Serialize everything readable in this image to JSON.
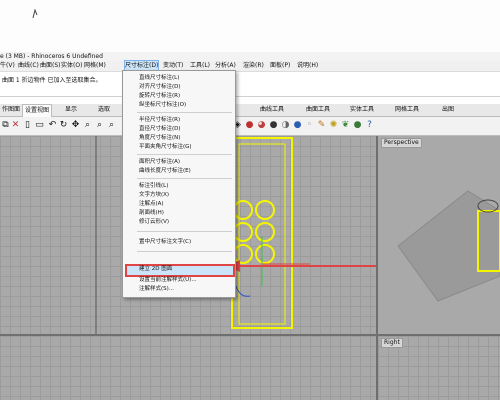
{
  "app": {
    "title": "e (3 MB) - Rhinoceros 6 Undefined"
  },
  "menubar": {
    "items": [
      {
        "label": "牛(V)"
      },
      {
        "label": "曲线(C)"
      },
      {
        "label": "曲面(S)"
      },
      {
        "label": "实体(O)"
      },
      {
        "label": "网格(M)"
      },
      {
        "label": "尺寸标注(D)"
      },
      {
        "label": "变动(T)"
      },
      {
        "label": "工具(L)"
      },
      {
        "label": "分析(A)"
      },
      {
        "label": "渲染(R)"
      },
      {
        "label": "面板(P)"
      },
      {
        "label": "说明(H)"
      }
    ]
  },
  "command": {
    "line1": "曲面 1 折边物件 已加入至选取集合。"
  },
  "tabs": [
    {
      "label": "作图面"
    },
    {
      "label": "设置视图"
    },
    {
      "label": "显示"
    },
    {
      "label": "选取"
    },
    {
      "label": "曲线工具"
    },
    {
      "label": "曲面工具"
    },
    {
      "label": "实体工具"
    },
    {
      "label": "网格工具"
    },
    {
      "label": "出图"
    }
  ],
  "viewports": {
    "perspective": "Perspective",
    "right": "Right"
  },
  "dropdown": {
    "items": [
      {
        "label": "直线尺寸标注(L)"
      },
      {
        "label": "对齐尺寸标注(D)"
      },
      {
        "label": "旋转尺寸标注(R)"
      },
      {
        "label": "纵坐标尺寸标注(O)"
      },
      {
        "label": "半径尺寸标注(R)"
      },
      {
        "label": "直径尺寸标注(D)"
      },
      {
        "label": "角度尺寸标注(N)"
      },
      {
        "label": "平面夹角尺寸标注(G)"
      },
      {
        "label": "面积尺寸标注(A)"
      },
      {
        "label": "曲线长度尺寸标注(E)"
      },
      {
        "label": "标注引线(L)"
      },
      {
        "label": "文字方块(X)"
      },
      {
        "label": "注解点(A)"
      },
      {
        "label": "剖面线(H)"
      },
      {
        "label": "修订云形(V)"
      },
      {
        "label": "置中尺寸标注文字(C)"
      },
      {
        "label": "建立 2D 图面"
      },
      {
        "label": "设置当前注解样式(U)..."
      },
      {
        "label": "注解样式(S)..."
      }
    ],
    "highlighted_index": 16
  },
  "colors": {
    "highlight_border": "#e04545",
    "geometry": "#f5f500",
    "viewport_bg": "#a9a9a9"
  }
}
